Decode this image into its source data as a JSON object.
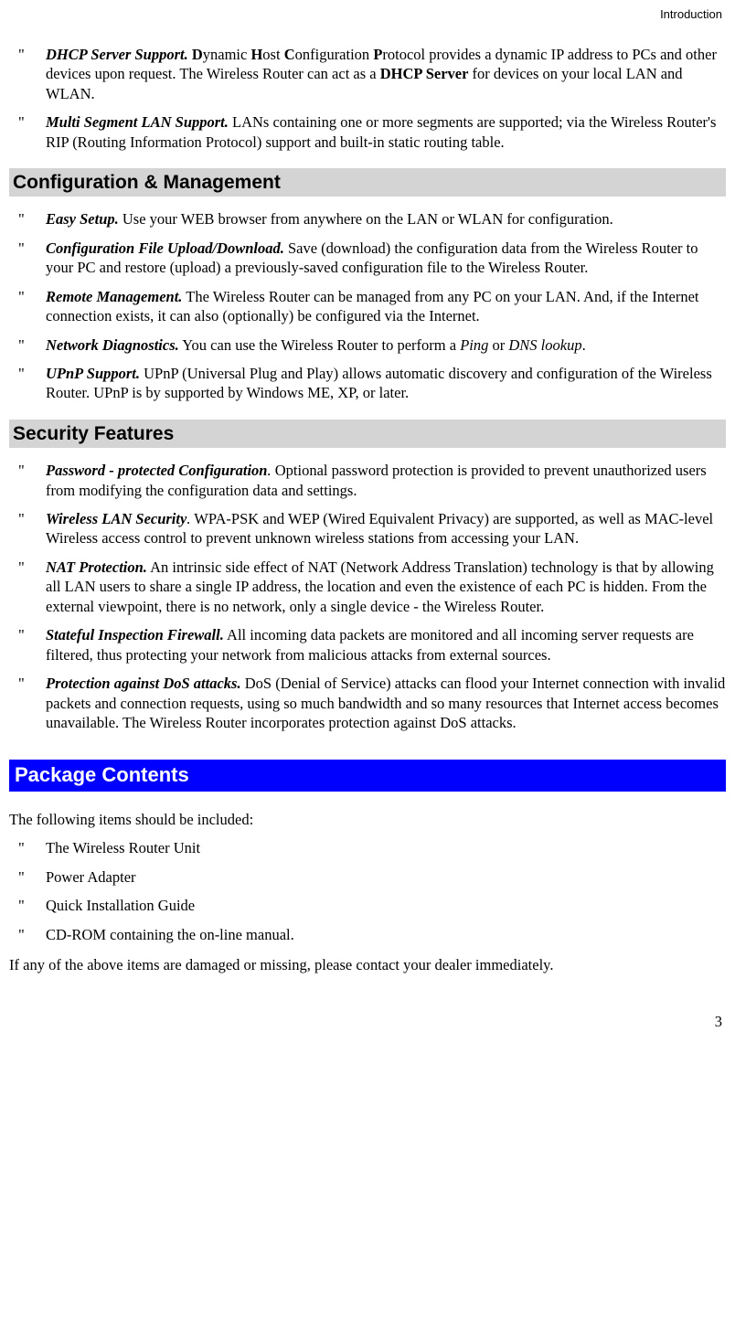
{
  "header": {
    "running_title": "Introduction"
  },
  "intro_features": [
    {
      "term": "DHCP Server Support.",
      "body_html": " <b>D</b>ynamic <b>H</b>ost <b>C</b>onfiguration <b>P</b>rotocol provides a dynamic IP address to PCs and other devices upon request. The Wireless Router can act as a <b>DHCP Server</b> for devices on your local LAN and WLAN."
    },
    {
      "term": "Multi Segment LAN Support.",
      "body_html": " LANs containing one or more segments are supported; via the Wireless Router's RIP (Routing Information Protocol) support and built-in static routing table."
    }
  ],
  "sections": [
    {
      "heading": "Configuration & Management",
      "items": [
        {
          "term": "Easy Setup.",
          "body_html": " Use your WEB browser from anywhere on the LAN or WLAN for configuration."
        },
        {
          "term": "Configuration File Upload/Download.",
          "body_html": " Save (download) the configuration data from the Wireless Router to your PC and restore (upload) a previously-saved configuration file to the Wireless Router."
        },
        {
          "term": "Remote Management.",
          "body_html": " The Wireless Router can be managed from any PC on your LAN. And, if the Internet connection exists, it can also (optionally) be configured via the Internet."
        },
        {
          "term": "Network Diagnostics.",
          "body_html": " You can use the Wireless Router to perform a <i>Ping</i> or <i>DNS lookup</i>."
        },
        {
          "term": "UPnP Support.",
          "body_html": " UPnP (Universal Plug and Play) allows automatic discovery and configuration of the Wireless Router. UPnP is by supported by Windows ME, XP, or later."
        }
      ]
    },
    {
      "heading": "Security Features",
      "items": [
        {
          "term": "Password - protected Configuration",
          "term_after": ".",
          "body_html": " Optional password protection is provided to prevent unauthorized users from modifying the configuration data and settings."
        },
        {
          "term": "Wireless LAN Security",
          "term_after": ".",
          "body_html": " WPA-PSK and WEP (Wired Equivalent Privacy) are supported, as well as MAC-level Wireless access control to prevent unknown wireless stations from accessing your LAN."
        },
        {
          "term": "NAT Protection.",
          "body_html": " An intrinsic side effect of NAT (Network Address Translation) technology is that by allowing all LAN users to share a single IP address, the location and even the existence of each PC is hidden. From the external viewpoint, there is no network, only a single device - the Wireless Router."
        },
        {
          "term": "Stateful Inspection Firewall.",
          "body_html": " All incoming data packets are monitored and all incoming server requests are filtered, thus protecting your network from malicious attacks from external sources."
        },
        {
          "term": "Protection against DoS attacks.",
          "body_html": " DoS (Denial of Service) attacks can flood your Internet connection with invalid packets and connection requests, using so much bandwidth and so many resources that Internet access becomes unavailable. The Wireless Router incorporates protection against DoS attacks."
        }
      ]
    }
  ],
  "package": {
    "heading": "Package Contents",
    "intro": "The following items should be included:",
    "items": [
      "The Wireless Router Unit",
      "Power Adapter",
      "Quick Installation Guide",
      "CD-ROM containing the on-line manual."
    ],
    "outro": "If any of the above items are damaged or missing, please contact your dealer immediately."
  },
  "page_number": "3"
}
